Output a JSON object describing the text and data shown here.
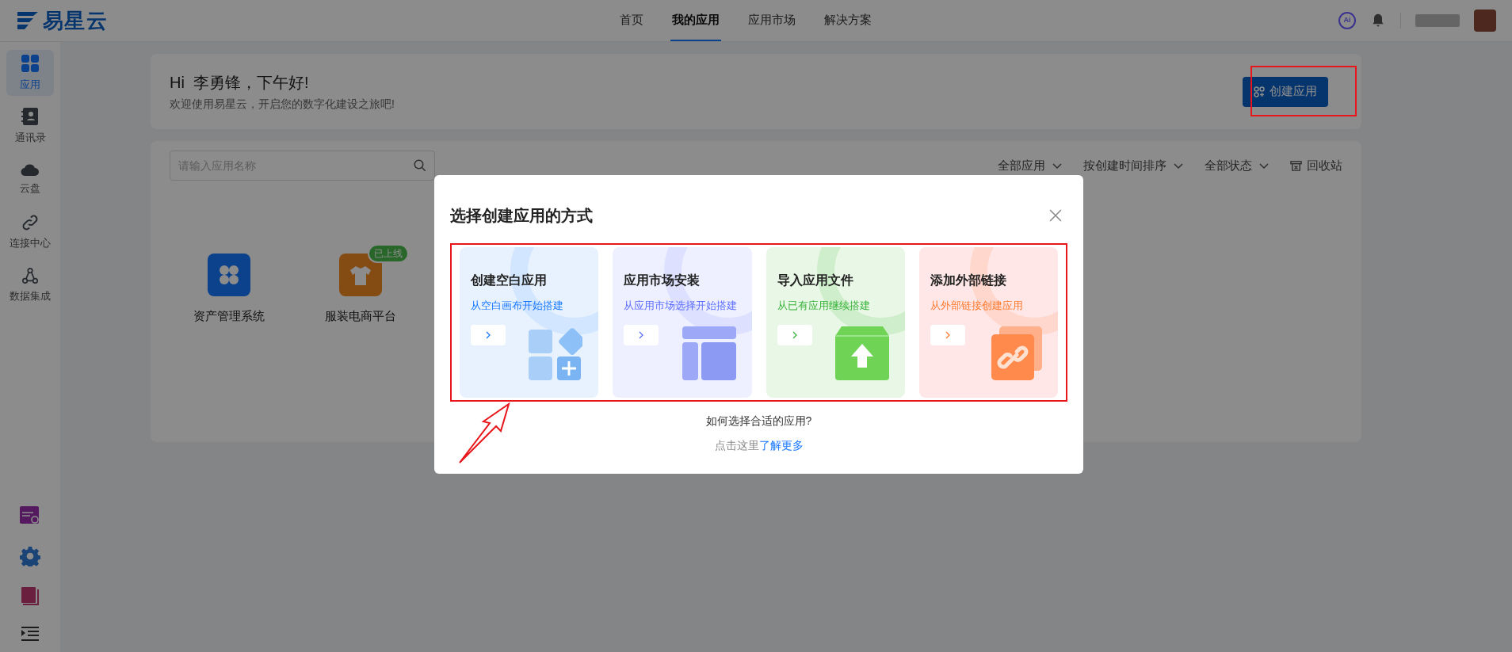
{
  "header": {
    "logo": "易星云",
    "nav": [
      {
        "label": "首页",
        "selected": false
      },
      {
        "label": "我的应用",
        "selected": true
      },
      {
        "label": "应用市场",
        "selected": false
      },
      {
        "label": "解决方案",
        "selected": false
      }
    ],
    "ai_badge": "Ai"
  },
  "sidebar": {
    "items": [
      {
        "label": "应用",
        "kind": "apps",
        "selected": true
      },
      {
        "label": "通讯录",
        "kind": "contacts",
        "selected": false
      },
      {
        "label": "云盘",
        "kind": "cloud",
        "selected": false
      },
      {
        "label": "连接中心",
        "kind": "link",
        "selected": false
      },
      {
        "label": "数据集成",
        "kind": "integration",
        "selected": false
      }
    ]
  },
  "greeting": {
    "title": "Hi  李勇锋，下午好!",
    "subtitle": "欢迎使用易星云，开启您的数字化建设之旅吧!",
    "create_button": "创建应用"
  },
  "toolbar": {
    "search_placeholder": "请输入应用名称",
    "filters": [
      "全部应用",
      "按创建时间排序",
      "全部状态"
    ],
    "recycle": "回收站"
  },
  "apps": [
    {
      "name": "资产管理系统",
      "kind": "clover"
    },
    {
      "name": "服装电商平台",
      "kind": "shirt",
      "badge": "已上线"
    }
  ],
  "dialog": {
    "title": "选择创建应用的方式",
    "options": [
      {
        "title": "创建空白应用",
        "subtitle": "从空白画布开始搭建",
        "kind": "blank",
        "color": "#1677ff"
      },
      {
        "title": "应用市场安装",
        "subtitle": "从应用市场选择开始搭建",
        "kind": "market",
        "color": "#5b6cff"
      },
      {
        "title": "导入应用文件",
        "subtitle": "从已有应用继续搭建",
        "kind": "import",
        "color": "#38b23a"
      },
      {
        "title": "添加外部链接",
        "subtitle": "从外部链接创建应用",
        "kind": "link",
        "color": "#ff7a2e"
      }
    ],
    "question": "如何选择合适的应用?",
    "hint": "点击这里",
    "link": "了解更多"
  }
}
